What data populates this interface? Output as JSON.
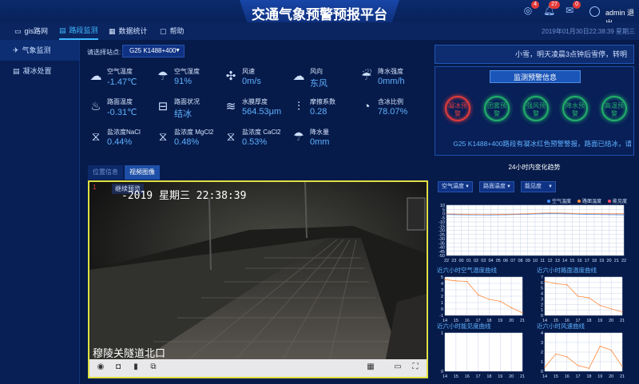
{
  "header": {
    "title": "交通气象预警预报平台",
    "badges": [
      "4",
      "27",
      "0"
    ],
    "username": "admin",
    "logout": "退出"
  },
  "nav": {
    "items": [
      "gis路网",
      "路段监测",
      "数据统计",
      "帮助"
    ],
    "active_index": 1,
    "datetime": "2019年01月30日22:38:39 星期三"
  },
  "sidebar": {
    "items": [
      "气象监测",
      "凝冰处置"
    ],
    "active_index": 0
  },
  "station": {
    "label": "请选择站点:",
    "selected": "G25 K1488+400"
  },
  "metrics": [
    {
      "label": "空气温度",
      "value": "-1.47℃",
      "icon": "air-temp-icon"
    },
    {
      "label": "空气湿度",
      "value": "91%",
      "icon": "humidity-icon"
    },
    {
      "label": "风速",
      "value": "0m/s",
      "icon": "wind-speed-icon"
    },
    {
      "label": "风向",
      "value": "东风",
      "icon": "wind-direction-icon"
    },
    {
      "label": "降水强度",
      "value": "0mm/h",
      "icon": "rain-intensity-icon"
    },
    {
      "label": "路面温度",
      "value": "-0.31℃",
      "icon": "road-temp-icon"
    },
    {
      "label": "路面状况",
      "value": "结冰",
      "icon": "road-condition-icon"
    },
    {
      "label": "水膜厚度",
      "value": "564.53μm",
      "icon": "water-film-icon"
    },
    {
      "label": "摩擦系数",
      "value": "0.28",
      "icon": "friction-icon"
    },
    {
      "label": "含冰比例",
      "value": "78.07%",
      "icon": "ice-ratio-icon"
    },
    {
      "label": "盐浓度NaCl",
      "value": "0.44%",
      "icon": "salt-nacl-icon"
    },
    {
      "label": "盐浓度 MgCl2",
      "value": "0.48%",
      "icon": "salt-mgcl2-icon"
    },
    {
      "label": "盐浓度 CaCl2",
      "value": "0.53%",
      "icon": "salt-cacl2-icon"
    },
    {
      "label": "降水量",
      "value": "0mm",
      "icon": "precipitation-icon"
    }
  ],
  "video": {
    "tabs": [
      "位置信息",
      "视频图像"
    ],
    "active_tab": 1,
    "rec": "1",
    "resume": "继续预览",
    "osd_time": "-2019 星期三 22:38:39",
    "osd_location": "穆陵关隧道北口"
  },
  "notice": "小雪，明天凌晨3点钟后雪停，转明",
  "monitor": {
    "title": "监测预警信息",
    "warnings": [
      {
        "label": "凝冰预警",
        "color": "#e23b3b"
      },
      {
        "label": "团雾预警",
        "color": "#22b06a"
      },
      {
        "label": "强风预警",
        "color": "#22b06a"
      },
      {
        "label": "降水预警",
        "color": "#22b06a"
      },
      {
        "label": "高温预警",
        "color": "#22b06a"
      }
    ],
    "alert_text": "G25 K1488+400路段有凝冰红色预警警报，路面已结冰，请"
  },
  "trend": {
    "title": "24小时内变化趋势",
    "dropdowns": [
      "空气温度",
      "路面温度",
      "能见度"
    ],
    "legend": [
      {
        "name": "空气温度",
        "color": "#3f8cff"
      },
      {
        "name": "路面温度",
        "color": "#ff8a3d"
      },
      {
        "name": "能见度",
        "color": "#ff4b6e"
      }
    ]
  },
  "mini_titles": [
    "近六小时空气温度曲线",
    "近六小时路面温度曲线",
    "近六小时能见度曲线",
    "近六小时风速曲线"
  ],
  "chart_data": [
    {
      "type": "line",
      "title": "24小时内变化趋势",
      "x": [
        "22",
        "23",
        "00",
        "01",
        "02",
        "03",
        "04",
        "05",
        "06",
        "07",
        "08",
        "09",
        "10",
        "11",
        "12",
        "13",
        "14",
        "15",
        "16",
        "17",
        "18",
        "19",
        "20",
        "21",
        "22"
      ],
      "ylim": [
        -50,
        10
      ],
      "yticks": [
        10,
        5,
        0,
        -5,
        -10,
        -15,
        -20,
        -25,
        -30,
        -35,
        -40,
        -45,
        -50
      ],
      "series": [
        {
          "name": "空气温度",
          "values": [
            -1.2,
            -1.3,
            -1.4,
            -1.5,
            -1.5,
            -1.6,
            -1.6,
            -1.5,
            -1.4,
            -1.2,
            -1.0,
            -0.8,
            -0.5,
            -0.3,
            -0.2,
            -0.2,
            -0.3,
            -0.5,
            -0.7,
            -0.9,
            -1.1,
            -1.2,
            -1.3,
            -1.4,
            -1.47
          ]
        },
        {
          "name": "路面温度",
          "values": [
            -0.5,
            -0.6,
            -0.8,
            -1.0,
            -1.1,
            -1.2,
            -1.1,
            -1.0,
            -0.9,
            -0.7,
            -0.5,
            -0.2,
            0.2,
            0.5,
            0.7,
            0.6,
            0.4,
            0.2,
            0.0,
            -0.1,
            -0.2,
            -0.3,
            -0.3,
            -0.3,
            -0.31
          ]
        }
      ]
    },
    {
      "type": "line",
      "title": "近六小时空气温度曲线",
      "x": [
        "14",
        "15",
        "16",
        "17",
        "18",
        "19",
        "20",
        "21"
      ],
      "ylim": [
        -1,
        5
      ],
      "yticks": [
        5,
        4,
        3,
        2,
        1,
        0,
        -1
      ],
      "series": [
        {
          "name": "",
          "values": [
            4.6,
            4.4,
            4.3,
            2.2,
            1.5,
            1.2,
            0.2,
            -0.6
          ]
        }
      ]
    },
    {
      "type": "line",
      "title": "近六小时路面温度曲线",
      "x": [
        "14",
        "15",
        "16",
        "17",
        "18",
        "19",
        "20",
        "21"
      ],
      "ylim": [
        0,
        7
      ],
      "yticks": [
        7,
        6,
        5,
        4,
        3,
        2,
        1,
        0
      ],
      "series": [
        {
          "name": "",
          "values": [
            6.2,
            5.8,
            5.6,
            3.5,
            3.2,
            1.8,
            1.2,
            0.6
          ]
        }
      ]
    },
    {
      "type": "line",
      "title": "近六小时能见度曲线",
      "x": [
        "14",
        "15",
        "16",
        "17",
        "18",
        "19",
        "20",
        "21"
      ],
      "ylim": [
        0,
        1
      ],
      "yticks": [
        1,
        0
      ],
      "series": []
    },
    {
      "type": "line",
      "title": "近六小时风速曲线",
      "x": [
        "14",
        "15",
        "16",
        "17",
        "18",
        "19",
        "20",
        "21"
      ],
      "ylim": [
        0,
        4
      ],
      "yticks": [
        4,
        3,
        2,
        1,
        0
      ],
      "series": [
        {
          "name": "",
          "values": [
            0.4,
            1.8,
            1.5,
            0.6,
            0.3,
            2.6,
            2.2,
            0.5
          ]
        }
      ]
    }
  ]
}
